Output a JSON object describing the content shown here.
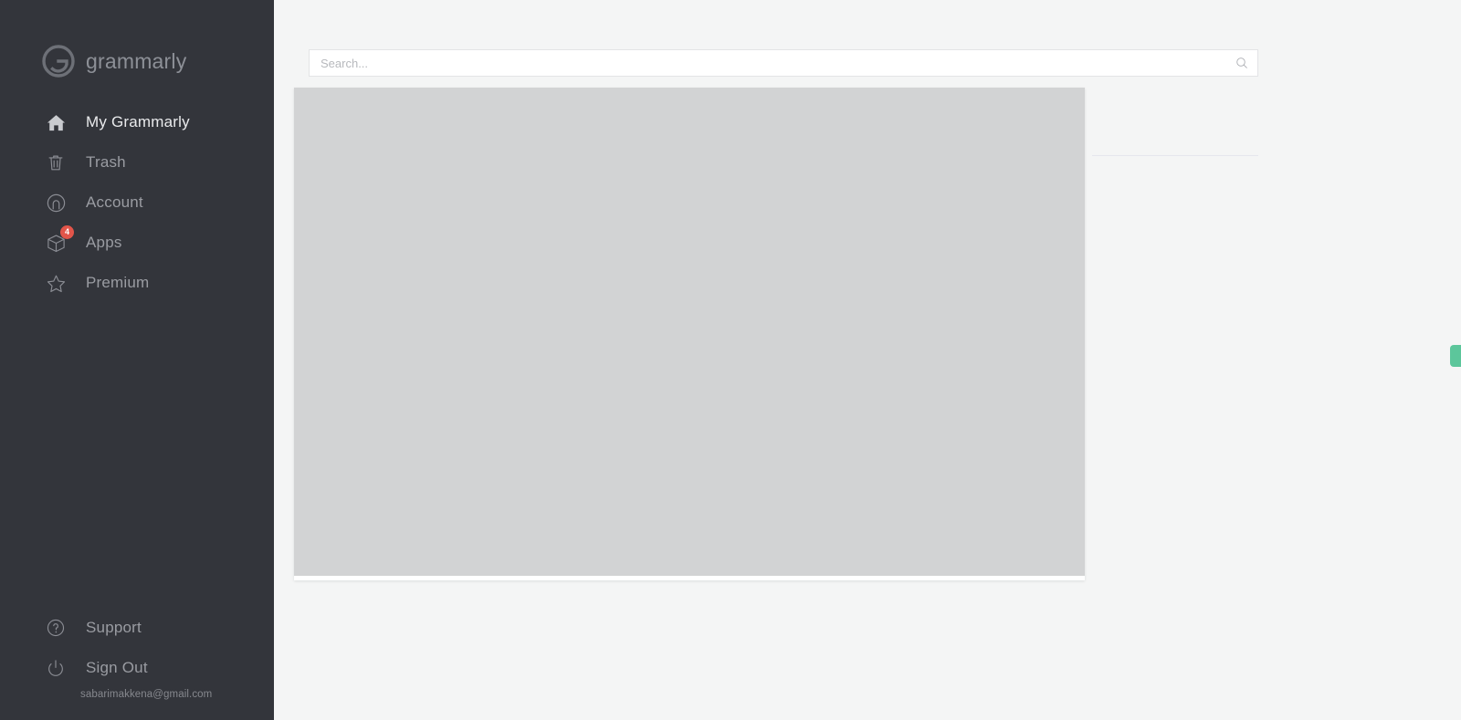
{
  "brand": {
    "logo_icon": "grammarly-g-logo-icon",
    "wordmark": "grammarly",
    "logo_color": "#8d9097"
  },
  "sidebar": {
    "background": "#33353b",
    "primary_items": [
      {
        "label": "My Grammarly",
        "icon": "home-icon",
        "active": true,
        "badge": null
      },
      {
        "label": "Trash",
        "icon": "trash-icon",
        "active": false,
        "badge": null
      },
      {
        "label": "Account",
        "icon": "account-icon",
        "active": false,
        "badge": null
      },
      {
        "label": "Apps",
        "icon": "box-icon",
        "active": false,
        "badge": "4"
      },
      {
        "label": "Premium",
        "icon": "star-icon",
        "active": false,
        "badge": null
      }
    ],
    "footer_items": [
      {
        "label": "Support",
        "icon": "question-circle-icon"
      },
      {
        "label": "Sign Out",
        "icon": "power-icon"
      }
    ],
    "account_email": "sabarimakkena@gmail.com",
    "badge_color": "#e2554a"
  },
  "main": {
    "search": {
      "placeholder": "Search...",
      "value": "",
      "icon": "search-icon"
    },
    "content_placeholder": {
      "state": "loading",
      "color": "#d2d3d4"
    },
    "widget_handle": {
      "name": "grammarly-widget-handle",
      "color": "#5cc69b"
    }
  },
  "page": {
    "background": "#f4f5f5"
  }
}
